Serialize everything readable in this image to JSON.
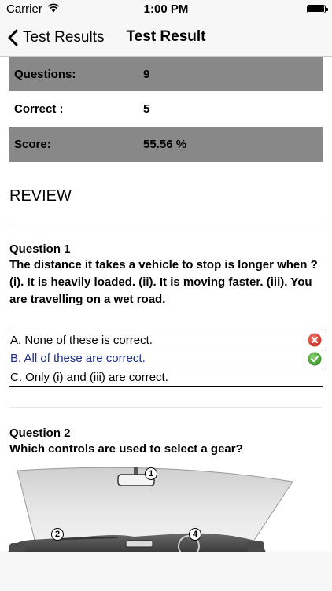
{
  "status_bar": {
    "carrier": "Carrier",
    "time": "1:00 PM"
  },
  "nav": {
    "back_label": "Test Results",
    "title": "Test Result"
  },
  "summary": {
    "rows": [
      {
        "label": "Questions:",
        "value": "9"
      },
      {
        "label": "Correct :",
        "value": "5"
      },
      {
        "label": "Score:",
        "value": "55.56 %"
      }
    ]
  },
  "review": {
    "heading": "REVIEW",
    "questions": [
      {
        "number": "Question 1",
        "text": "The distance it takes a vehicle to stop is longer when ? (i). It is heavily loaded. (ii). It is moving faster. (iii). You are travelling on a wet road.",
        "options": [
          {
            "text": "A. None of these is correct.",
            "status": "wrong"
          },
          {
            "text": "B. All of these are correct.",
            "status": "correct"
          },
          {
            "text": "C. Only (i) and (iii) are correct.",
            "status": "none"
          }
        ]
      },
      {
        "number": "Question 2",
        "text": "Which controls are used to select a gear?",
        "figure_callouts": [
          "1",
          "2",
          "4"
        ]
      }
    ]
  },
  "colors": {
    "shaded_row": "#888888",
    "correct_text": "#1c2d8c",
    "correct_icon": "#3aa12e",
    "wrong_icon": "#d9332b"
  }
}
